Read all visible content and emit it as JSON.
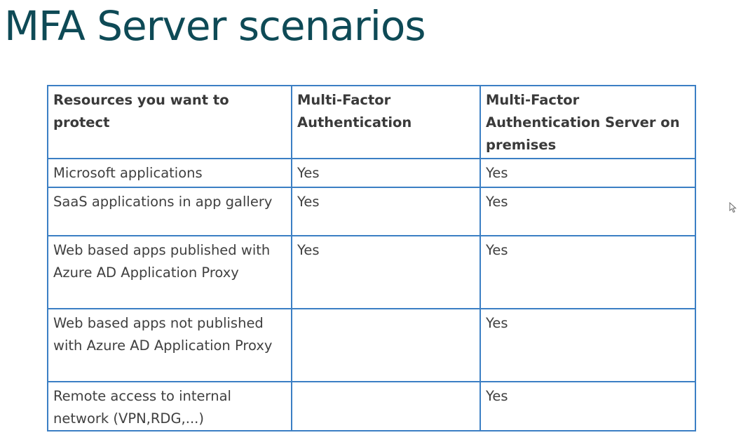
{
  "title": "MFA Server scenarios",
  "table": {
    "headers": [
      "Resources you want to protect",
      "Multi-Factor Authentication",
      "Multi-Factor Authentication Server on premises"
    ],
    "rows": [
      [
        "Microsoft applications",
        "Yes",
        "Yes"
      ],
      [
        "SaaS applications in app gallery",
        "Yes",
        "Yes"
      ],
      [
        "Web based apps published with Azure AD Application Proxy",
        "Yes",
        "Yes"
      ],
      [
        "Web based apps not published with Azure AD Application Proxy",
        "",
        "Yes"
      ],
      [
        "Remote access to internal network (VPN,RDG,...)",
        "",
        "Yes"
      ]
    ]
  },
  "colors": {
    "title": "#0e4a56",
    "table_border": "#3b7fc4",
    "text": "#404040"
  },
  "icons": {
    "cursor": "mouse-pointer-icon"
  }
}
